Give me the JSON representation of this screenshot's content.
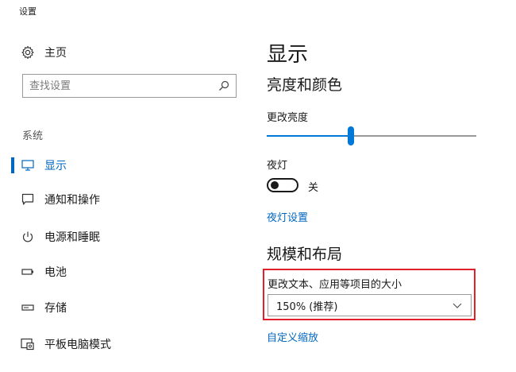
{
  "window": {
    "title": "设置"
  },
  "sidebar": {
    "home_label": "主页",
    "search_placeholder": "查找设置",
    "section_label": "系统",
    "items": [
      {
        "label": "显示",
        "icon": "monitor-icon",
        "active": true
      },
      {
        "label": "通知和操作",
        "icon": "notification-icon",
        "active": false
      },
      {
        "label": "电源和睡眠",
        "icon": "power-icon",
        "active": false
      },
      {
        "label": "电池",
        "icon": "battery-icon",
        "active": false
      },
      {
        "label": "存储",
        "icon": "storage-icon",
        "active": false
      },
      {
        "label": "平板电脑模式",
        "icon": "tablet-mode-icon",
        "active": false
      }
    ]
  },
  "main": {
    "title": "显示",
    "brightness_section": {
      "title": "亮度和颜色",
      "brightness_label": "更改亮度",
      "brightness_level_fraction": 0.4,
      "night_light_label": "夜灯",
      "night_light_state": "关",
      "night_light_settings_link": "夜灯设置"
    },
    "scale_section": {
      "title": "规模和布局",
      "scale_label": "更改文本、应用等项目的大小",
      "scale_value": "150% (推荐)",
      "custom_scaling_link": "自定义缩放"
    }
  },
  "colors": {
    "accent": "#0078d7",
    "link": "#0067c0",
    "highlight_border": "#e0202a"
  }
}
